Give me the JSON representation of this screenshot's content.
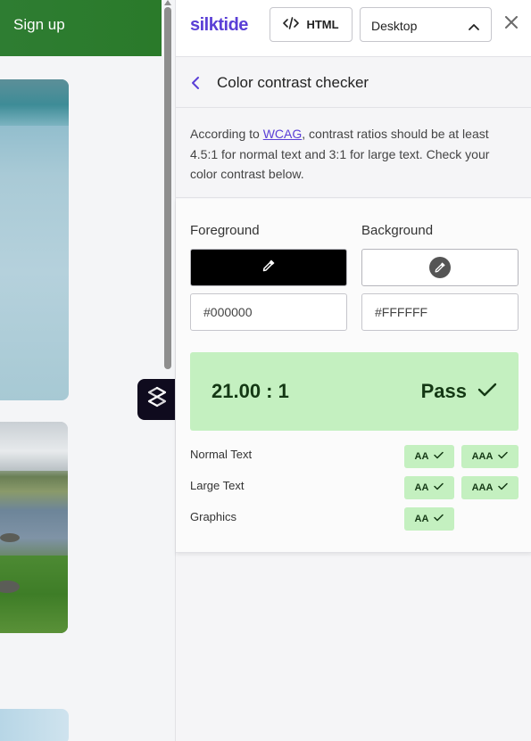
{
  "background_page": {
    "signup_label": "Sign up"
  },
  "panel": {
    "logo": "silktide",
    "html_button_label": "HTML",
    "view_select": {
      "selected": "Desktop"
    },
    "title": "Color contrast checker",
    "intro": {
      "prefix": "According to ",
      "link_text": "WCAG",
      "suffix": ", contrast ratios should be at least 4.5:1 for normal text and 3:1 for large text. Check your color contrast below."
    },
    "foreground": {
      "label": "Foreground",
      "value": "#000000",
      "color": "#000000"
    },
    "background": {
      "label": "Background",
      "value": "#FFFFFF",
      "color": "#FFFFFF"
    },
    "result": {
      "ratio": "21.00 : 1",
      "status": "Pass"
    },
    "rows": [
      {
        "label": "Normal Text",
        "badges": [
          "AA",
          "AAA"
        ]
      },
      {
        "label": "Large Text",
        "badges": [
          "AA",
          "AAA"
        ]
      },
      {
        "label": "Graphics",
        "badges": [
          "AA"
        ]
      }
    ]
  },
  "colors": {
    "brand": "#5a3fd6",
    "pass_bg": "#c4f0c0",
    "pass_text": "#143814",
    "header_green": "#2e7d32"
  }
}
